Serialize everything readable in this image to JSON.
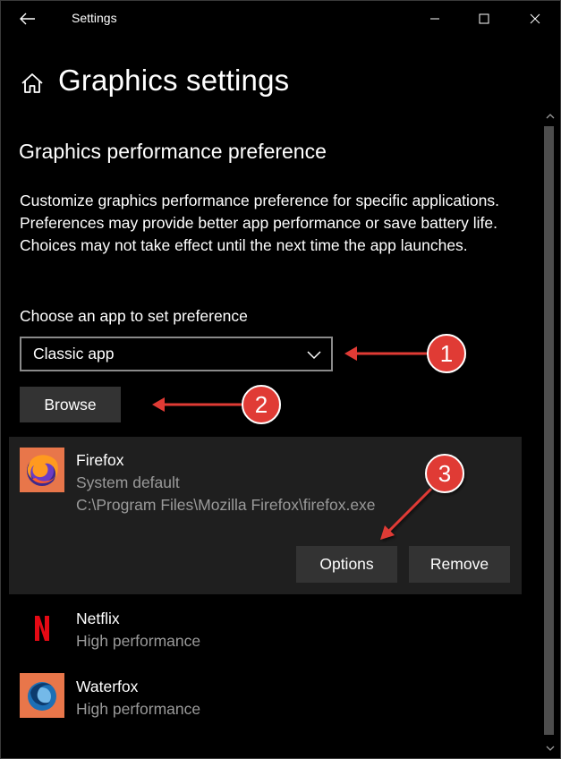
{
  "window": {
    "title": "Settings"
  },
  "header": {
    "page_title": "Graphics settings"
  },
  "section": {
    "title": "Graphics performance preference",
    "description": "Customize graphics performance preference for specific applications. Preferences may provide better app performance or save battery life. Choices may not take effect until the next time the app launches."
  },
  "chooser": {
    "label": "Choose an app to set preference",
    "selected": "Classic app",
    "browse_label": "Browse"
  },
  "apps": [
    {
      "name": "Firefox",
      "preference": "System default",
      "path": "C:\\Program Files\\Mozilla Firefox\\firefox.exe",
      "icon": "firefox-icon",
      "selected": true
    },
    {
      "name": "Netflix",
      "preference": "High performance",
      "icon": "netflix-icon"
    },
    {
      "name": "Waterfox",
      "preference": "High performance",
      "icon": "waterfox-icon"
    }
  ],
  "selected_app_actions": {
    "options_label": "Options",
    "remove_label": "Remove"
  },
  "annotations": [
    {
      "number": "1"
    },
    {
      "number": "2"
    },
    {
      "number": "3"
    }
  ],
  "colors": {
    "background": "#000000",
    "selected_row": "#1f1f1f",
    "button": "#333333",
    "secondary_text": "#9a9a9a",
    "annotation_red": "#e03a36"
  }
}
